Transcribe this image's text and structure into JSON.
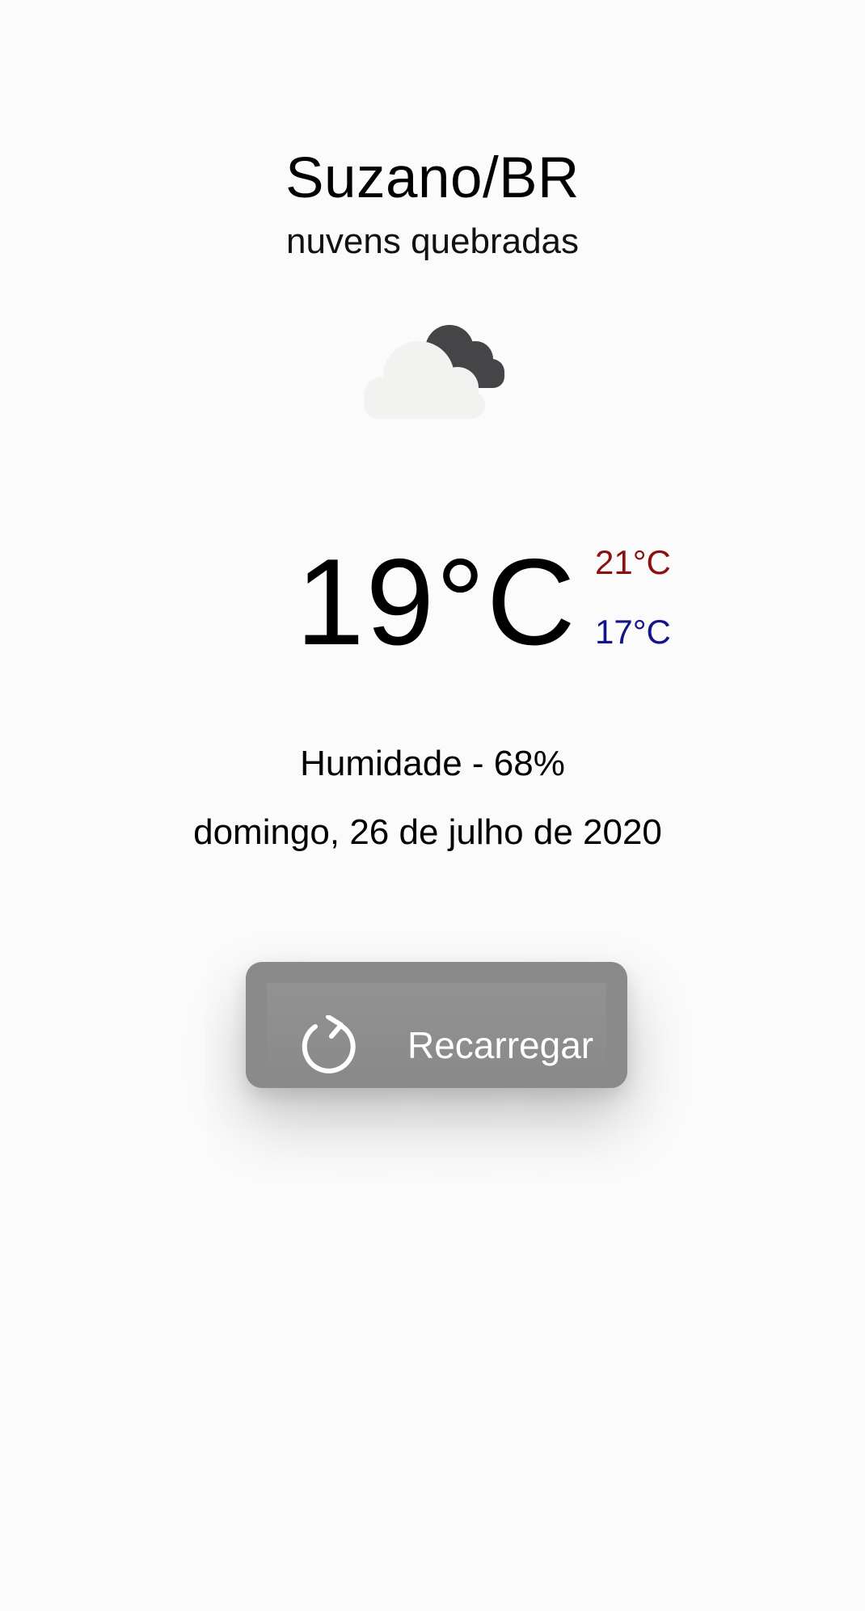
{
  "location": {
    "city": "Suzano/BR",
    "description": "nuvens quebradas"
  },
  "weather": {
    "icon": "broken-clouds-icon",
    "temperature": "19°C",
    "max": "21°C",
    "min": "17°C",
    "humidity": "Humidade - 68%",
    "date": "domingo, 26 de julho de 2020"
  },
  "colors": {
    "max": "#8c1010",
    "min": "#14148a",
    "button": "#8a8a8a"
  },
  "actions": {
    "reload_label": "Recarregar",
    "reload_icon": "refresh-icon"
  }
}
